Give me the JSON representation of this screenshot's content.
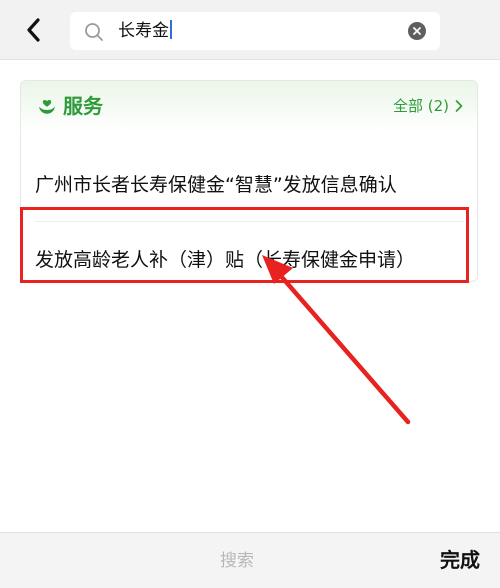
{
  "search": {
    "query": "长寿金",
    "icons": {
      "back": "chevron-left-icon",
      "search": "search-icon",
      "clear": "clear-circle-icon"
    }
  },
  "services": {
    "section_title": "服务",
    "section_icon": "heart-hands-icon",
    "all_label": "全部 (2)",
    "items": [
      {
        "label": "广州市长者长寿保健金“智慧”发放信息确认"
      },
      {
        "label": "发放高龄老人补（津）贴（长寿保健金申请）"
      }
    ]
  },
  "bottom_bar": {
    "search_label": "搜索",
    "done_label": "完成"
  },
  "colors": {
    "accent_green": "#2e9a3a",
    "annotation_red": "#e8221f",
    "caret_blue": "#2f6fd6"
  }
}
